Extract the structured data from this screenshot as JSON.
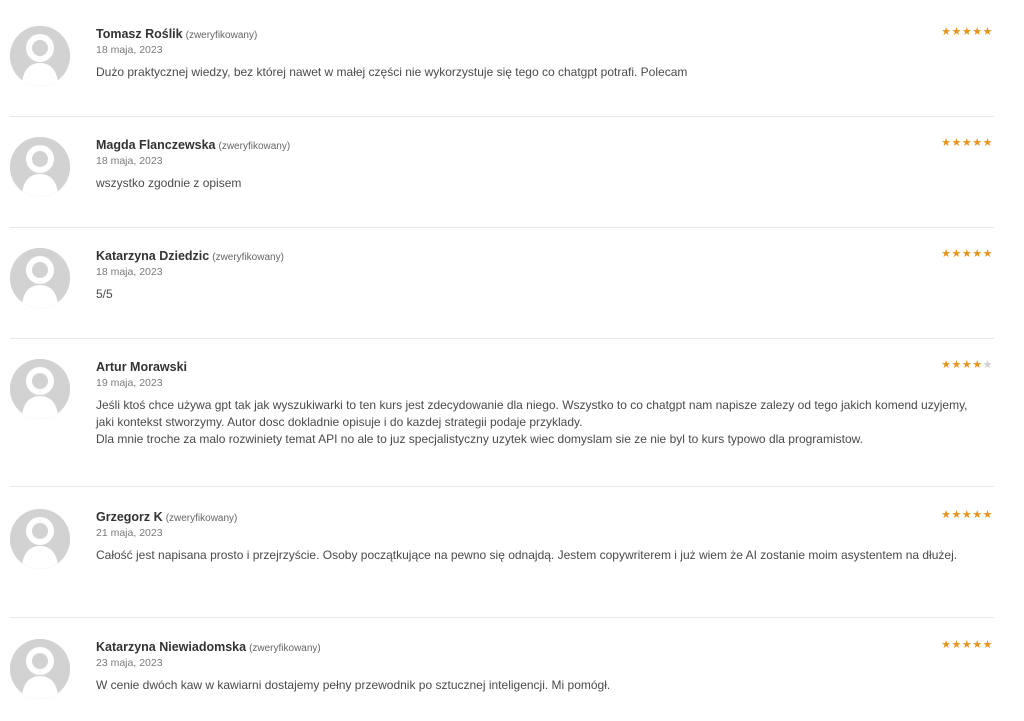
{
  "colors": {
    "star_filled": "#e8941a",
    "star_empty": "#cfcfcf",
    "avatar_bg": "#d2d2d2",
    "avatar_fg": "#ffffff"
  },
  "icons": {
    "avatar": "user-silhouette-icon",
    "star": "star-icon"
  },
  "reviews": [
    {
      "author": "Tomasz Roślik",
      "verified": "(zweryfikowany)",
      "date": "18 maja, 2023",
      "rating": 5,
      "text": [
        "Dużo praktycznej wiedzy, bez której nawet w małej części nie wykorzystuje się tego co chatgpt potrafi. Polecam"
      ]
    },
    {
      "author": "Magda Flanczewska",
      "verified": "(zweryfikowany)",
      "date": "18 maja, 2023",
      "rating": 5,
      "text": [
        "wszystko zgodnie z opisem"
      ]
    },
    {
      "author": "Katarzyna Dziedzic",
      "verified": "(zweryfikowany)",
      "date": "18 maja, 2023",
      "rating": 5,
      "text": [
        "5/5"
      ]
    },
    {
      "author": "Artur Morawski",
      "verified": "",
      "date": "19 maja, 2023",
      "rating": 4,
      "text": [
        "Jeśli ktoś chce używa gpt tak jak wyszukiwarki to ten kurs jest zdecydowanie dla niego. Wszystko to co chatgpt nam napisze zalezy od tego jakich komend uzyjemy, jaki kontekst stworzymy. Autor dosc dokladnie opisuje i do kazdej strategii podaje przyklady.",
        "Dla mnie troche za malo rozwiniety temat API no ale to juz specjalistyczny uzytek wiec domyslam sie ze nie byl to kurs typowo dla programistow."
      ]
    },
    {
      "author": "Grzegorz K",
      "verified": "(zweryfikowany)",
      "date": "21 maja, 2023",
      "rating": 5,
      "text": [
        "Całość jest napisana prosto i przejrzyście. Osoby początkujące na pewno się odnajdą. Jestem copywriterem i już wiem że AI zostanie moim asystentem na dłużej."
      ]
    },
    {
      "author": "Katarzyna Niewiadomska",
      "verified": "(zweryfikowany)",
      "date": "23 maja, 2023",
      "rating": 5,
      "text": [
        "W cenie dwóch kaw w kawiarni dostajemy pełny przewodnik po sztucznej inteligencji. Mi pomógł."
      ]
    }
  ]
}
